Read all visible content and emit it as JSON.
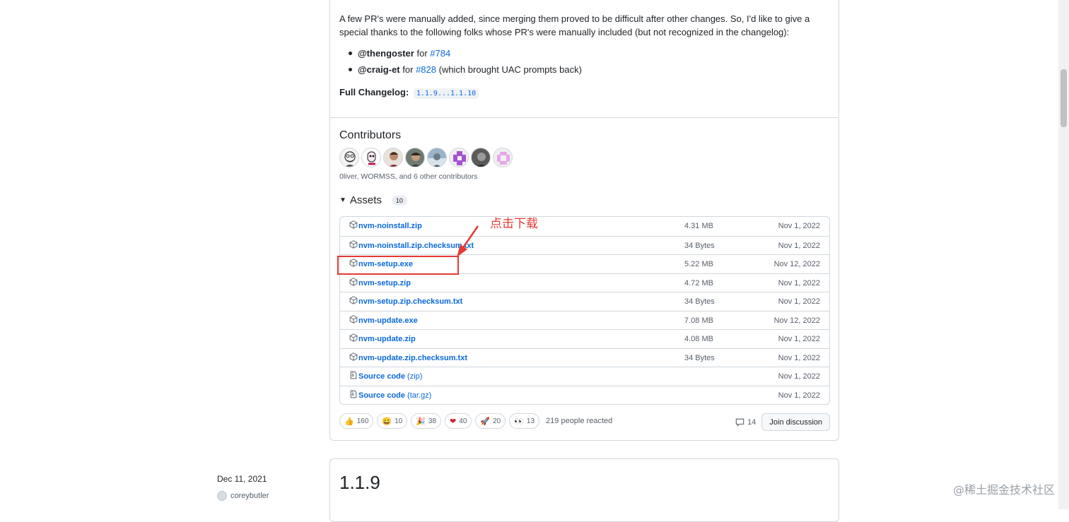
{
  "release_notes": {
    "intro": "A few PR's were manually added, since merging them proved to be difficult after other changes. So, I'd like to give a special thanks to the following folks whose PR's were manually included (but not recognized in the changelog):",
    "thanks": [
      {
        "user": "@thengoster",
        "for_text": "for",
        "pr": "#784",
        "note": ""
      },
      {
        "user": "@craig-et",
        "for_text": "for",
        "pr": "#828",
        "note": "(which brought UAC prompts back)"
      }
    ],
    "changelog_label": "Full Changelog:",
    "changelog_range": "1.1.9...1.1.10"
  },
  "contributors": {
    "title": "Contributors",
    "summary": "0liver, WORMSS, and 6 other contributors"
  },
  "assets": {
    "title": "Assets",
    "count": "10",
    "items": [
      {
        "name": "nvm-noinstall.zip",
        "suffix": "",
        "size": "4.31 MB",
        "date": "Nov 1, 2022",
        "icon": "package-icon"
      },
      {
        "name": "nvm-noinstall.zip.checksum.txt",
        "suffix": "",
        "size": "34 Bytes",
        "date": "Nov 1, 2022",
        "icon": "package-icon"
      },
      {
        "name": "nvm-setup.exe",
        "suffix": "",
        "size": "5.22 MB",
        "date": "Nov 12, 2022",
        "icon": "package-icon"
      },
      {
        "name": "nvm-setup.zip",
        "suffix": "",
        "size": "4.72 MB",
        "date": "Nov 1, 2022",
        "icon": "package-icon"
      },
      {
        "name": "nvm-setup.zip.checksum.txt",
        "suffix": "",
        "size": "34 Bytes",
        "date": "Nov 1, 2022",
        "icon": "package-icon"
      },
      {
        "name": "nvm-update.exe",
        "suffix": "",
        "size": "7.08 MB",
        "date": "Nov 12, 2022",
        "icon": "package-icon"
      },
      {
        "name": "nvm-update.zip",
        "suffix": "",
        "size": "4.08 MB",
        "date": "Nov 1, 2022",
        "icon": "package-icon"
      },
      {
        "name": "nvm-update.zip.checksum.txt",
        "suffix": "",
        "size": "34 Bytes",
        "date": "Nov 1, 2022",
        "icon": "package-icon"
      },
      {
        "name": "Source code",
        "suffix": "(zip)",
        "size": "",
        "date": "Nov 1, 2022",
        "icon": "file-zip-icon"
      },
      {
        "name": "Source code",
        "suffix": "(tar.gz)",
        "size": "",
        "date": "Nov 1, 2022",
        "icon": "file-zip-icon"
      }
    ]
  },
  "reactions": {
    "items": [
      {
        "emoji": "👍",
        "icon": "thumbs-up-icon",
        "count": "160"
      },
      {
        "emoji": "😄",
        "icon": "smile-icon",
        "count": "10"
      },
      {
        "emoji": "🎉",
        "icon": "tada-icon",
        "count": "38"
      },
      {
        "emoji": "❤",
        "icon": "heart-icon",
        "count": "40"
      },
      {
        "emoji": "🚀",
        "icon": "rocket-icon",
        "count": "20"
      },
      {
        "emoji": "👀",
        "icon": "eyes-icon",
        "count": "13"
      }
    ],
    "summary": "219 people reacted"
  },
  "discussion": {
    "comments": "14",
    "button": "Join discussion"
  },
  "annotation": {
    "text": "点击下载",
    "color": "#e53935"
  },
  "next_release": {
    "date": "Dec 11, 2021",
    "author": "coreybutler",
    "version": "1.1.9"
  },
  "watermark": "@稀土掘金技术社区",
  "colors": {
    "link": "#0969da",
    "border": "#d0d7de",
    "muted": "#57606a",
    "annotation_red": "#e53935"
  }
}
